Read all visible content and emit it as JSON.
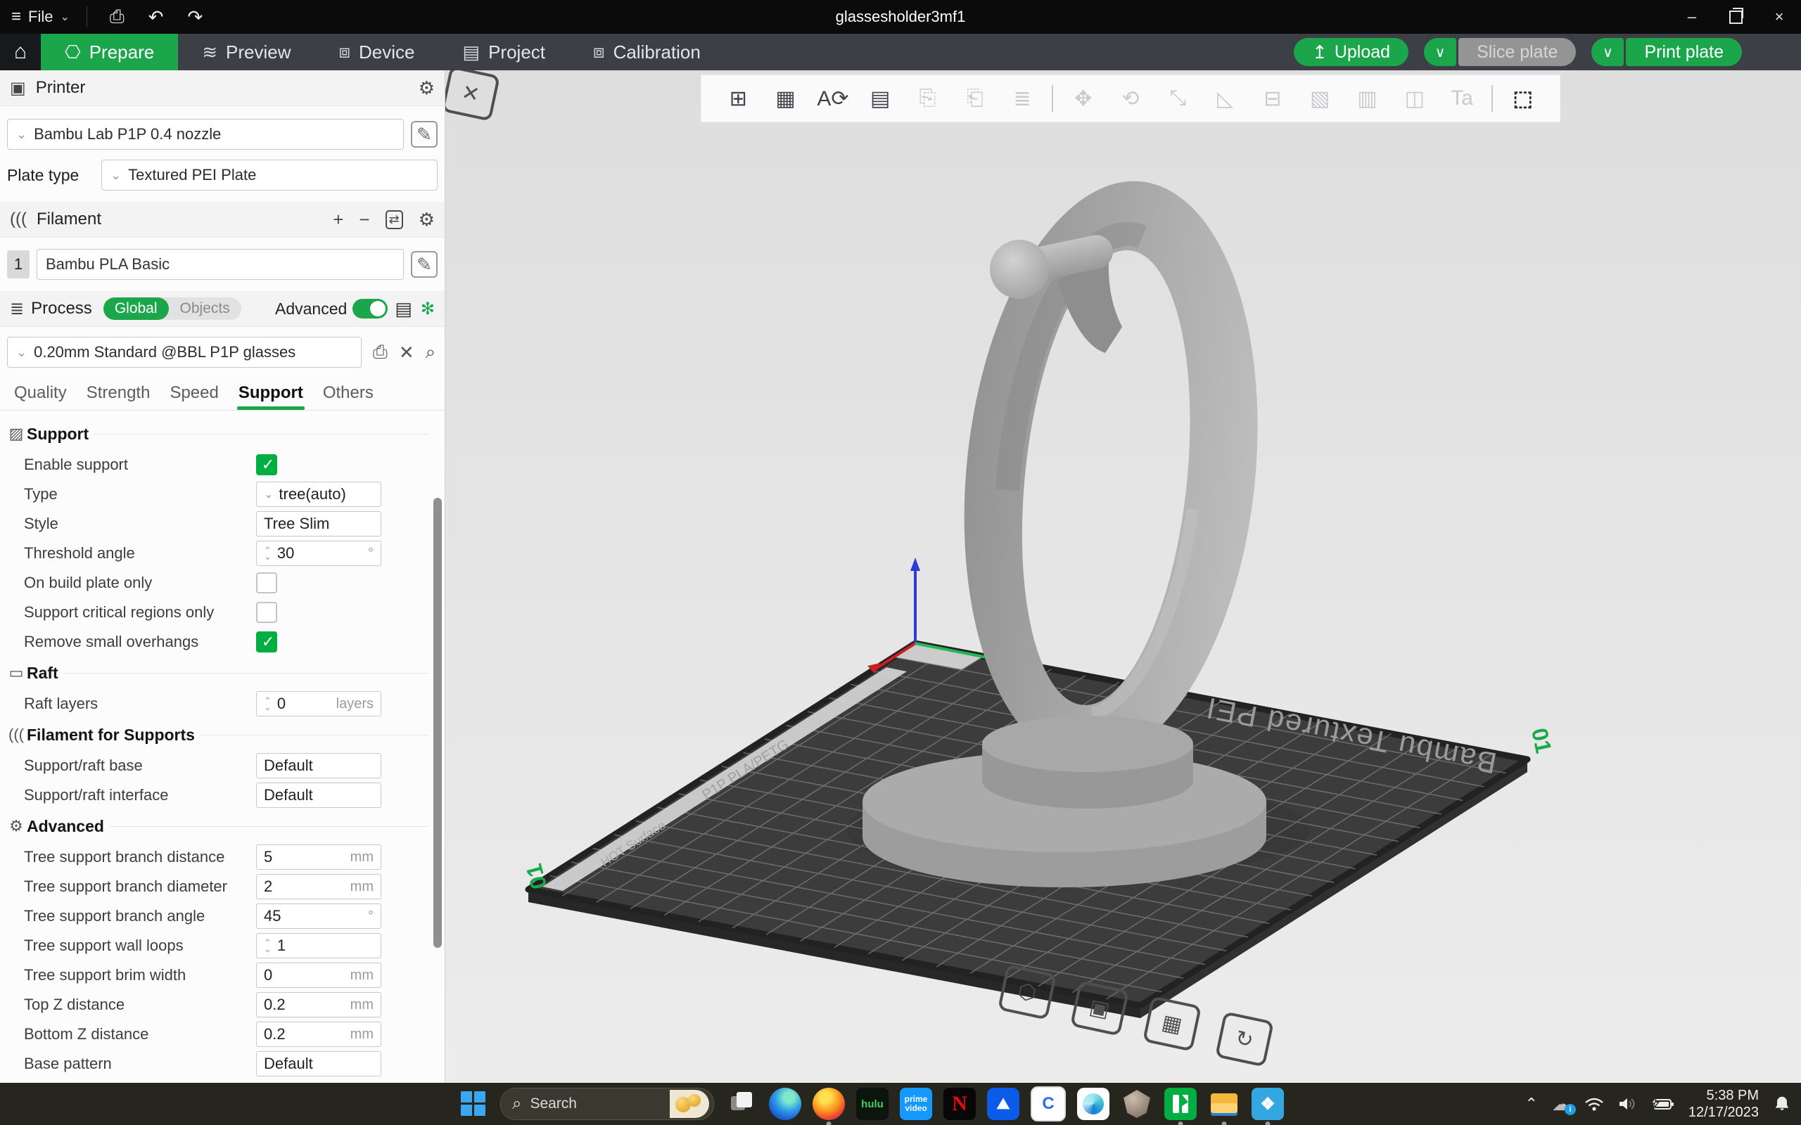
{
  "titlebar": {
    "menu_label": "File",
    "title": "glassesholder3mf1"
  },
  "navbar": {
    "tabs": [
      {
        "label": "Prepare",
        "glyph": "⎔",
        "cls": "active"
      },
      {
        "label": "Preview",
        "glyph": "≋",
        "cls": ""
      },
      {
        "label": "Device",
        "glyph": "⧈",
        "cls": ""
      },
      {
        "label": "Project",
        "glyph": "▤",
        "cls": ""
      },
      {
        "label": "Calibration",
        "glyph": "⧈",
        "cls": ""
      }
    ],
    "upload_label": "Upload",
    "slice_label": "Slice plate",
    "print_label": "Print plate"
  },
  "printer": {
    "section_title": "Printer",
    "name": "Bambu Lab P1P 0.4 nozzle",
    "plate_type_label": "Plate type",
    "plate_type": "Textured PEI Plate"
  },
  "filament": {
    "section_title": "Filament",
    "slot": "1",
    "name": "Bambu PLA Basic"
  },
  "process": {
    "section_title": "Process",
    "scope_global": "Global",
    "scope_objects": "Objects",
    "advanced_label": "Advanced",
    "preset": "0.20mm Standard @BBL P1P glasses",
    "tabs": [
      {
        "label": "Quality",
        "cls": ""
      },
      {
        "label": "Strength",
        "cls": ""
      },
      {
        "label": "Speed",
        "cls": ""
      },
      {
        "label": "Support",
        "cls": "active"
      },
      {
        "label": "Others",
        "cls": ""
      }
    ]
  },
  "settings": {
    "items": [
      {
        "type": "header",
        "icon": "▨",
        "title": "Support"
      },
      {
        "type": "row",
        "label": "Enable support",
        "control": "cb",
        "checked": true
      },
      {
        "type": "row",
        "label": "Type",
        "control": "box",
        "chevron": true,
        "value": "tree(auto)"
      },
      {
        "type": "row",
        "label": "Style",
        "control": "box",
        "value": "Tree Slim"
      },
      {
        "type": "row",
        "label": "Threshold angle",
        "control": "box",
        "spinner": true,
        "value": "30",
        "unit": "°"
      },
      {
        "type": "row",
        "label": "On build plate only",
        "control": "cb",
        "checked": false
      },
      {
        "type": "row",
        "label": "Support critical regions only",
        "control": "cb",
        "checked": false
      },
      {
        "type": "row",
        "label": "Remove small overhangs",
        "control": "cb",
        "checked": true
      },
      {
        "type": "header",
        "icon": "▭",
        "title": "Raft"
      },
      {
        "type": "row",
        "label": "Raft layers",
        "control": "box",
        "spinner": true,
        "value": "0",
        "unit": "layers"
      },
      {
        "type": "header",
        "icon": "(((",
        "title": "Filament for Supports"
      },
      {
        "type": "row",
        "label": "Support/raft base",
        "control": "box",
        "value": "Default"
      },
      {
        "type": "row",
        "label": "Support/raft interface",
        "control": "box",
        "value": "Default"
      },
      {
        "type": "header",
        "icon": "⚙",
        "title": "Advanced"
      },
      {
        "type": "row",
        "label": "Tree support branch distance",
        "control": "box",
        "value": "5",
        "unit": "mm"
      },
      {
        "type": "row",
        "label": "Tree support branch diameter",
        "control": "box",
        "value": "2",
        "unit": "mm"
      },
      {
        "type": "row",
        "label": "Tree support branch angle",
        "control": "box",
        "value": "45",
        "unit": "°"
      },
      {
        "type": "row",
        "label": "Tree support wall loops",
        "control": "box",
        "spinner": true,
        "value": "1",
        "unit": ""
      },
      {
        "type": "row",
        "label": "Tree support brim width",
        "control": "box",
        "value": "0",
        "unit": "mm"
      },
      {
        "type": "row",
        "label": "Top Z distance",
        "control": "box",
        "value": "0.2",
        "unit": "mm"
      },
      {
        "type": "row",
        "label": "Bottom Z distance",
        "control": "box",
        "value": "0.2",
        "unit": "mm"
      },
      {
        "type": "row",
        "label": "Base pattern",
        "control": "box",
        "value": "Default"
      }
    ]
  },
  "viewport": {
    "toolbar": [
      {
        "name": "add-model-icon",
        "glyph": "⊞",
        "cls": "on"
      },
      {
        "name": "add-plate-icon",
        "glyph": "▦",
        "cls": "on"
      },
      {
        "name": "auto-orient-icon",
        "glyph": "A⟳",
        "cls": "on"
      },
      {
        "name": "arrange-icon",
        "glyph": "▤",
        "cls": "on"
      },
      {
        "name": "copy-icon",
        "glyph": "⎘",
        "cls": "off"
      },
      {
        "name": "paste-icon",
        "glyph": "⎗",
        "cls": "off"
      },
      {
        "name": "layer-list-icon",
        "glyph": "≣",
        "cls": "off"
      },
      {
        "name": "toolbar-divider",
        "glyph": "",
        "cls": "sep"
      },
      {
        "name": "move-icon",
        "glyph": "✥",
        "cls": "off"
      },
      {
        "name": "rotate-icon",
        "glyph": "⟲",
        "cls": "off"
      },
      {
        "name": "scale-icon",
        "glyph": "⤡",
        "cls": "off"
      },
      {
        "name": "lay-on-face-icon",
        "glyph": "◺",
        "cls": "off"
      },
      {
        "name": "split-icon",
        "glyph": "⊟",
        "cls": "off"
      },
      {
        "name": "variable-layer-icon",
        "glyph": "▧",
        "cls": "off"
      },
      {
        "name": "support-paint-icon",
        "glyph": "▥",
        "cls": "off"
      },
      {
        "name": "mesh-boolean-icon",
        "glyph": "◫",
        "cls": "off"
      },
      {
        "name": "text-tool-icon",
        "glyph": "Ta",
        "cls": "off"
      },
      {
        "name": "toolbar-divider",
        "glyph": "",
        "cls": "sep"
      },
      {
        "name": "assembly-icon",
        "glyph": "⬚",
        "cls": "accent"
      }
    ],
    "plate": {
      "brand_text": "Bambu Textured PEI",
      "edge_label": "P1P PLA/PETG",
      "edge_label2": "HOT Surface",
      "plate_number": "01"
    },
    "plate_buttons": [
      {
        "name": "plate-settings-icon",
        "glyph": "⬡"
      },
      {
        "name": "plate-lock-icon",
        "glyph": "▣"
      },
      {
        "name": "plate-arrange-icon",
        "glyph": "▦"
      },
      {
        "name": "plate-orient-icon",
        "glyph": "↻"
      },
      {
        "name": "plate-delete-icon",
        "glyph": "✕"
      }
    ]
  },
  "taskbar": {
    "search_placeholder": "Search",
    "apps": [
      {
        "name": "task-view-icon",
        "cls": "tv",
        "label": "",
        "dot": false
      },
      {
        "name": "edge-icon",
        "cls": "edge",
        "label": "",
        "dot": false
      },
      {
        "name": "firefox-icon",
        "cls": "firefox",
        "label": "",
        "dot": true
      },
      {
        "name": "hulu-icon",
        "cls": "hulu",
        "label": "hulu",
        "dot": false
      },
      {
        "name": "prime-video-icon",
        "cls": "prime",
        "label": "prime video",
        "dot": false
      },
      {
        "name": "netflix-icon",
        "cls": "netflix",
        "label": "N",
        "dot": false
      },
      {
        "name": "paramount-icon",
        "cls": "paramount",
        "label": "⛰",
        "dot": false
      },
      {
        "name": "c-shield-app-icon",
        "cls": "cshield",
        "label": "C",
        "dot": false
      },
      {
        "name": "blue-swirl-app-icon",
        "cls": "swirl",
        "label": "",
        "dot": false
      },
      {
        "name": "gem-app-icon",
        "cls": "gem",
        "label": "",
        "dot": false
      },
      {
        "name": "bambu-studio-icon",
        "cls": "bambu",
        "label": "",
        "dot": true
      },
      {
        "name": "file-explorer-icon",
        "cls": "folder",
        "label": "",
        "dot": true
      },
      {
        "name": "bambu-handy-icon",
        "cls": "handy",
        "label": "❖",
        "dot": true
      }
    ],
    "tray": {
      "time": "5:38 PM",
      "date": "12/17/2023"
    }
  }
}
